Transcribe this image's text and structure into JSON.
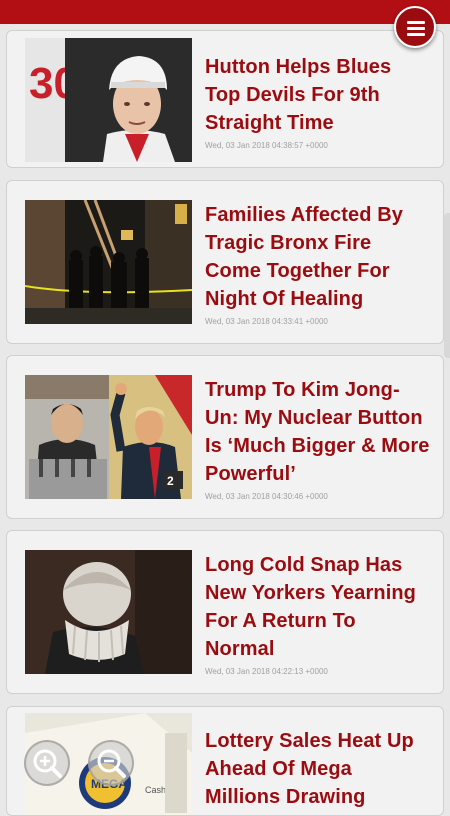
{
  "app": {
    "menu_icon": "hamburger-menu-icon",
    "accent_color": "#b20f14",
    "title_color": "#9a0c10"
  },
  "articles": [
    {
      "title": "Hutton Helps Blues Top Devils For 9th Straight Time",
      "timestamp": "Wed, 03 Jan 2018 04:38:57 +0000",
      "image": "hockey-player-photo"
    },
    {
      "title": "Families Affected By Tragic Bronx Fire Come Together For Night Of Healing",
      "timestamp": "Wed, 03 Jan 2018 04:33:41 +0000",
      "image": "bronx-fire-scene-photo"
    },
    {
      "title": "Trump To Kim Jong-Un: My Nuclear Button Is ‘Much Bigger & More Powerful’",
      "timestamp": "Wed, 03 Jan 2018 04:30:46 +0000",
      "image": "kim-and-trump-photo"
    },
    {
      "title": "Long Cold Snap Has New Yorkers Yearning For A Return To Normal",
      "timestamp": "Wed, 03 Jan 2018 04:22:13 +0000",
      "image": "cold-pedestrian-photo"
    },
    {
      "title": "Lottery Sales Heat Up Ahead Of Mega Millions Drawing",
      "timestamp": "",
      "image": "lottery-ticket-photo"
    }
  ],
  "zoom": {
    "in_icon": "zoom-in-icon",
    "out_icon": "zoom-out-icon"
  }
}
